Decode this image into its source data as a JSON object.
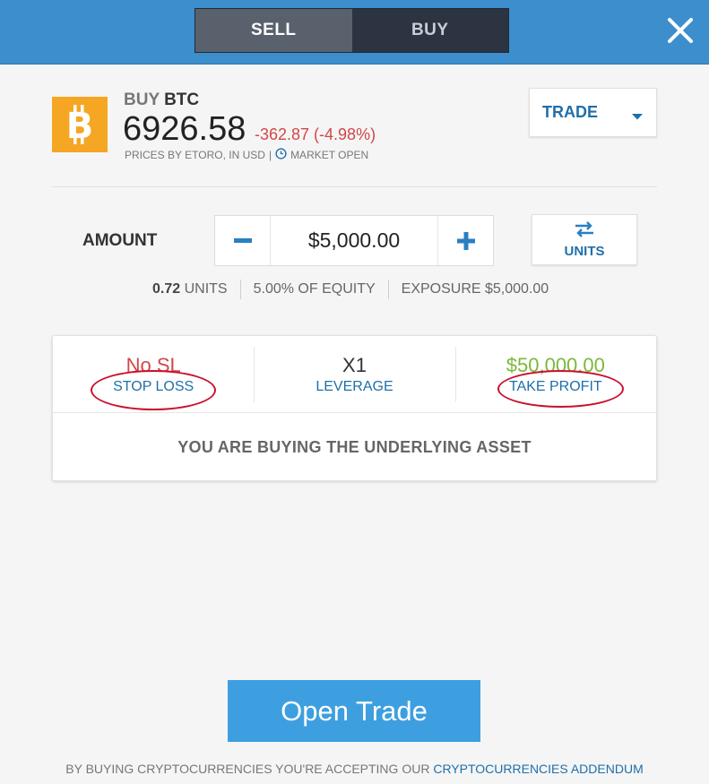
{
  "header": {
    "tabs": {
      "sell": "SELL",
      "buy": "BUY"
    },
    "active_tab": "SELL",
    "close_icon": "close-icon",
    "colors": {
      "bar": "#3d8ecc",
      "sell": "#58616c",
      "buy": "#2b3440"
    }
  },
  "asset": {
    "icon": "bitcoin-icon",
    "action": "BUY",
    "symbol": "BTC",
    "price": "6926.58",
    "change": "-362.87 (-4.98%)",
    "prices_by": "PRICES BY ETORO, IN USD",
    "separator": "|",
    "market_icon": "clock-icon",
    "market_status": "MARKET OPEN"
  },
  "order_type": {
    "label": "TRADE",
    "icon": "chevron-down-icon"
  },
  "amount": {
    "label": "AMOUNT",
    "value": "$5,000.00",
    "decrement_icon": "minus-icon",
    "increment_icon": "plus-icon",
    "switch_icon": "swap-arrows-icon",
    "switch_label": "UNITS"
  },
  "stats": {
    "units_value": "0.72",
    "units_label": "UNITS",
    "equity": "5.00% OF EQUITY",
    "exposure": "EXPOSURE $5,000.00"
  },
  "settings": {
    "stop_loss": {
      "value": "No SL",
      "label": "STOP LOSS"
    },
    "leverage": {
      "value": "X1",
      "label": "LEVERAGE"
    },
    "take_profit": {
      "value": "$50,000.00",
      "label": "TAKE PROFIT"
    },
    "note": "YOU ARE BUYING THE UNDERLYING ASSET"
  },
  "open_trade": {
    "label": "Open Trade",
    "color": "#3d9fe0"
  },
  "footer": {
    "text": "BY BUYING CRYPTOCURRENCIES YOU'RE ACCEPTING OUR",
    "link": "CRYPTOCURRENCIES ADDENDUM"
  }
}
